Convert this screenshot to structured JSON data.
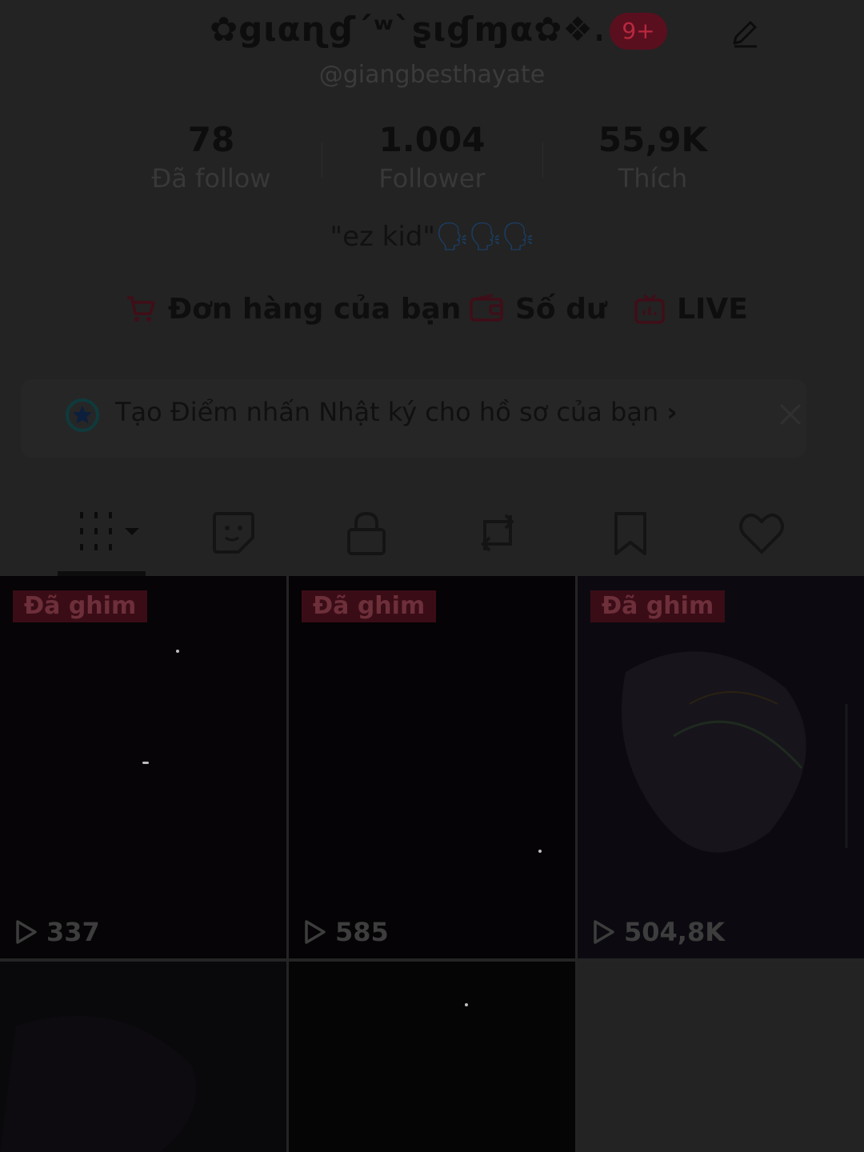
{
  "profile": {
    "display_name": "✿gιαɳɠ´ʷ`ʂιɠɱα✿❖...",
    "notification_badge": "9+",
    "handle": "@giangbesthayate",
    "bio_text": "\"ez kid\"",
    "bio_emoji": "🗣🗣🗣"
  },
  "stats": [
    {
      "value": "78",
      "label": "Đã follow"
    },
    {
      "value": "1.004",
      "label": "Follower"
    },
    {
      "value": "55,9K",
      "label": "Thích"
    }
  ],
  "quick_links": {
    "orders": "Đơn hàng của bạn",
    "balance": "Số dư",
    "live": "LIVE"
  },
  "banner": {
    "text": "Tạo Điểm nhấn Nhật ký cho hồ sơ của bạn",
    "chevron": "›"
  },
  "tabs": [
    "videos-grid-icon",
    "sticker-icon",
    "lock-icon",
    "repost-icon",
    "bookmark-icon",
    "heart-icon"
  ],
  "videos": [
    {
      "pinned": "Đã ghim",
      "views": "337"
    },
    {
      "pinned": "Đã ghim",
      "views": "585"
    },
    {
      "pinned": "Đã ghim",
      "views": "504,8K"
    },
    {
      "pinned": "",
      "views": ""
    },
    {
      "pinned": "",
      "views": ""
    }
  ],
  "colors": {
    "accent": "#fe2c55",
    "overlay_dim": "#232323"
  }
}
